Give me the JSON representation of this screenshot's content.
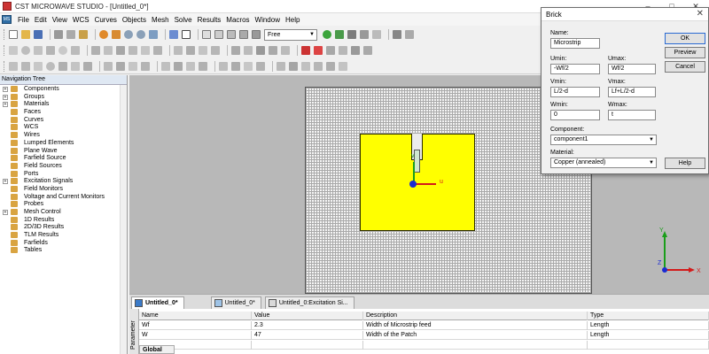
{
  "window": {
    "title": "CST MICROWAVE STUDIO - [Untitled_0*]"
  },
  "menubar": {
    "items": [
      "File",
      "Edit",
      "View",
      "WCS",
      "Curves",
      "Objects",
      "Mesh",
      "Solve",
      "Results",
      "Macros",
      "Window",
      "Help"
    ]
  },
  "toolbar": {
    "view_mode_value": "Free"
  },
  "navigation_tree": {
    "title": "Navigation Tree",
    "items": [
      {
        "label": "Components",
        "expandable": true,
        "icon_color": "#d9a441"
      },
      {
        "label": "Groups",
        "expandable": true,
        "icon_color": "#d9a441"
      },
      {
        "label": "Materials",
        "expandable": true,
        "icon_color": "#d9a441"
      },
      {
        "label": "Faces",
        "expandable": false,
        "icon_color": "#d9a441"
      },
      {
        "label": "Curves",
        "expandable": false,
        "icon_color": "#d9a441"
      },
      {
        "label": "WCS",
        "expandable": false,
        "icon_color": "#d9a441"
      },
      {
        "label": "Wires",
        "expandable": false,
        "icon_color": "#d9a441"
      },
      {
        "label": "Lumped Elements",
        "expandable": false,
        "icon_color": "#d9a441"
      },
      {
        "label": "Plane Wave",
        "expandable": false,
        "icon_color": "#d9a441"
      },
      {
        "label": "Farfield Source",
        "expandable": false,
        "icon_color": "#d9a441"
      },
      {
        "label": "Field Sources",
        "expandable": false,
        "icon_color": "#d9a441"
      },
      {
        "label": "Ports",
        "expandable": false,
        "icon_color": "#d9a441"
      },
      {
        "label": "Excitation Signals",
        "expandable": true,
        "icon_color": "#d9a441"
      },
      {
        "label": "Field Monitors",
        "expandable": false,
        "icon_color": "#d9a441"
      },
      {
        "label": "Voltage and Current Monitors",
        "expandable": false,
        "icon_color": "#d9a441"
      },
      {
        "label": "Probes",
        "expandable": false,
        "icon_color": "#d9a441"
      },
      {
        "label": "Mesh Control",
        "expandable": true,
        "icon_color": "#d9a441"
      },
      {
        "label": "1D Results",
        "expandable": false,
        "icon_color": "#d9a441"
      },
      {
        "label": "2D/3D Results",
        "expandable": false,
        "icon_color": "#d9a441"
      },
      {
        "label": "TLM Results",
        "expandable": false,
        "icon_color": "#d9a441"
      },
      {
        "label": "Farfields",
        "expandable": false,
        "icon_color": "#d9a441"
      },
      {
        "label": "Tables",
        "expandable": false,
        "icon_color": "#d9a441"
      }
    ]
  },
  "viewport": {
    "axis_u_label": "u",
    "axis_v_label": "v",
    "triad_labels": [
      "Y",
      "Z",
      "X"
    ]
  },
  "tabs": [
    {
      "label": "Untitled_0*",
      "active": true
    },
    {
      "label": "Untitled_0*",
      "active": false
    },
    {
      "label": "Untitled_0:Excitation Si...",
      "active": false
    }
  ],
  "parameter_list": {
    "side_label": "Parameter",
    "global_tab": "Global",
    "columns": [
      "Name",
      "Value",
      "Description",
      "Type"
    ],
    "rows": [
      [
        "Wf",
        "2.3",
        "Width of Microstrip feed",
        "Length"
      ],
      [
        "W",
        "47",
        "Width of the Patch",
        "Length"
      ],
      [
        "",
        "",
        "",
        ""
      ]
    ]
  },
  "brick_dialog": {
    "title": "Brick",
    "name_label": "Name:",
    "name_value": "Microstrip",
    "umin_label": "Umin:",
    "umin_value": "-Wf/2",
    "umax_label": "Umax:",
    "umax_value": "Wf/2",
    "vmin_label": "Vmin:",
    "vmin_value": "L/2-d",
    "vmax_label": "Vmax:",
    "vmax_value": "Lf+L/2-d",
    "wmin_label": "Wmin:",
    "wmin_value": "0",
    "wmax_label": "Wmax:",
    "wmax_value": "t",
    "component_label": "Component:",
    "component_value": "component1",
    "material_label": "Material:",
    "material_value": "Copper (annealed)",
    "buttons": {
      "ok": "OK",
      "preview": "Preview",
      "cancel": "Cancel",
      "help": "Help"
    }
  },
  "colors": {
    "patch": "#ffff00",
    "grid_bg": "#f4f4f4",
    "viewport_bg": "#b8b8b8",
    "axis_u": "#d31a1a",
    "axis_v": "#1a9e1a"
  }
}
